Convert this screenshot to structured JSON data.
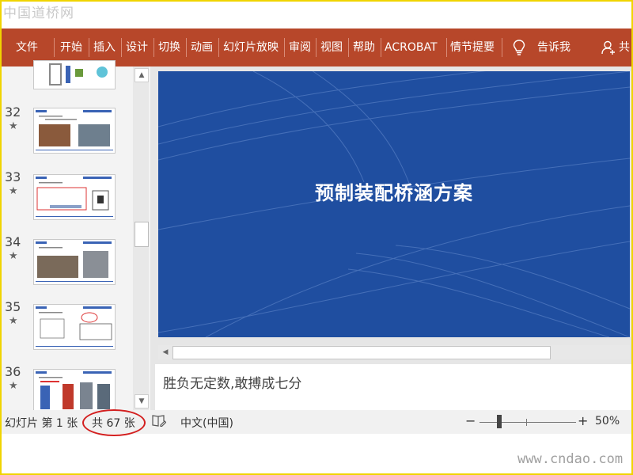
{
  "watermark": {
    "top": "中国道桥网",
    "bottom": "www.cndao.com"
  },
  "ribbon": {
    "tabs": [
      "文件",
      "开始",
      "插入",
      "设计",
      "切换",
      "动画",
      "幻灯片放映",
      "审阅",
      "视图",
      "帮助",
      "ACROBAT",
      "情节提要"
    ],
    "tell_me": "告诉我",
    "share": "共"
  },
  "thumbnails": [
    {
      "number": "32"
    },
    {
      "number": "33"
    },
    {
      "number": "34"
    },
    {
      "number": "35"
    },
    {
      "number": "36"
    }
  ],
  "slide": {
    "title": "预制装配桥涵方案",
    "background": "#1f4ea0"
  },
  "notes": {
    "text": "胜负无定数,敢搏成七分"
  },
  "status": {
    "slide_label": "幻灯片 第 1 张",
    "total_label": "共 67 张",
    "language": "中文(中国)",
    "zoom_minus": "−",
    "zoom_plus": "+",
    "zoom_value": "50%"
  },
  "colors": {
    "ribbon": "#b7472a",
    "annotation_circle": "#d31f1f",
    "frame": "#f0d400"
  }
}
